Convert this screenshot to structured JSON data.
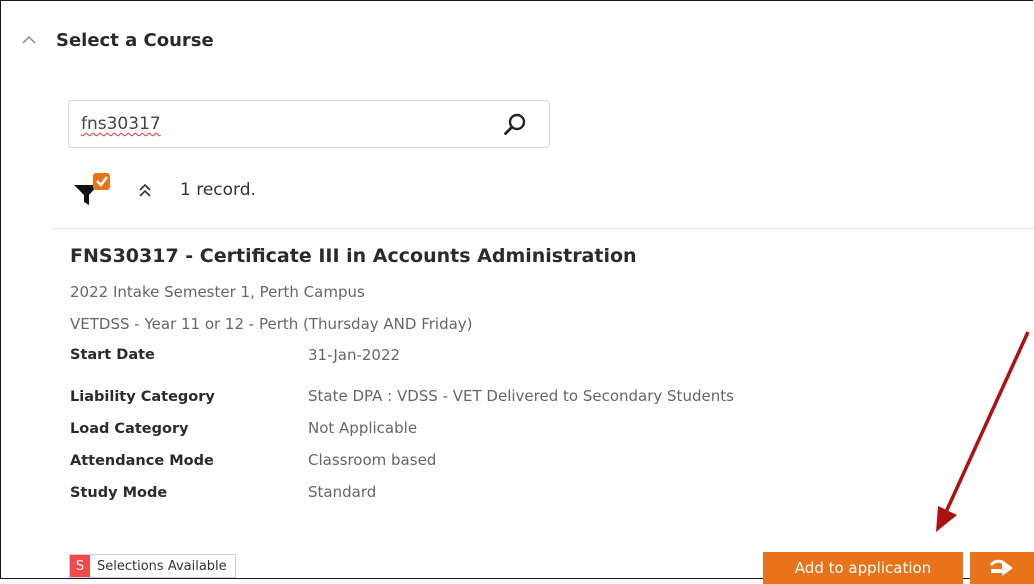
{
  "section": {
    "title": "Select a Course"
  },
  "search": {
    "value": "fns30317"
  },
  "results": {
    "count_text": "1 record."
  },
  "course": {
    "title": "FNS30317 - Certificate III in Accounts Administration",
    "intake": "2022 Intake Semester 1, Perth Campus",
    "program": "VETDSS - Year 11 or 12 - Perth (Thursday AND Friday)",
    "details": [
      {
        "label": "Start Date",
        "value": "31-Jan-2022"
      },
      {
        "label": "Liability Category",
        "value": "State DPA : VDSS - VET Delivered to Secondary Students"
      },
      {
        "label": "Load Category",
        "value": "Not Applicable"
      },
      {
        "label": "Attendance Mode",
        "value": "Classroom based"
      },
      {
        "label": "Study Mode",
        "value": "Standard"
      }
    ],
    "badge": {
      "letter": "S",
      "text": "Selections Available"
    }
  },
  "actions": {
    "add_label": "Add to application"
  },
  "colors": {
    "accent": "#e8731a",
    "badge": "#f04a4a",
    "annotation": "#b01010"
  },
  "icons": {
    "collapse": "chevron-up-icon",
    "search": "search-icon",
    "filter": "filter-icon",
    "expand": "double-chevron-up-icon",
    "go": "forward-arrow-icon"
  }
}
